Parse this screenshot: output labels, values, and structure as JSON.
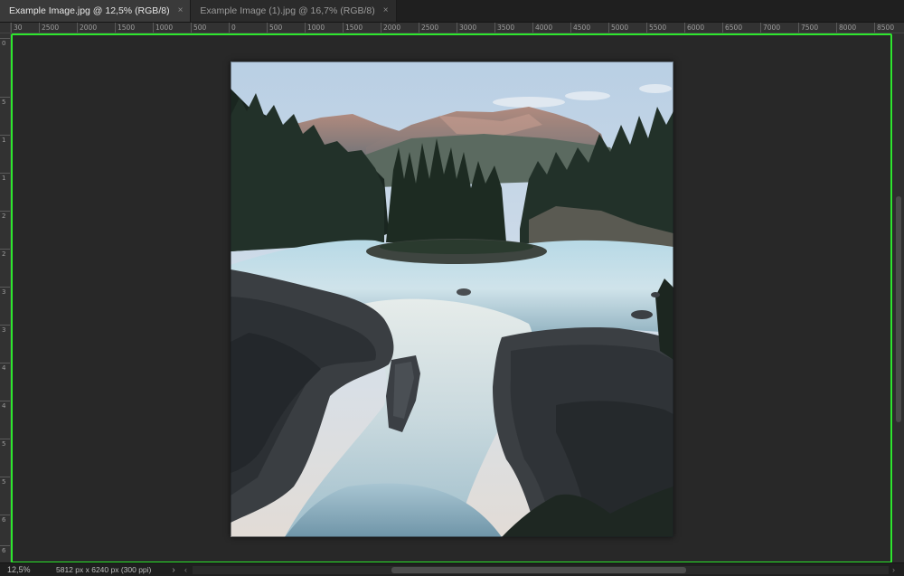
{
  "tabs": [
    {
      "label": "Example Image.jpg @ 12,5% (RGB/8)",
      "close": "×",
      "active": true
    },
    {
      "label": "Example Image (1).jpg @ 16,7% (RGB/8)",
      "close": "×",
      "active": false
    }
  ],
  "ruler": {
    "top_labels": [
      "30",
      "2500",
      "2000",
      "1500",
      "1000",
      "500",
      "0",
      "500",
      "1000",
      "1500",
      "2000",
      "2500",
      "3000",
      "3500",
      "4000",
      "4500",
      "5000",
      "5500",
      "6000",
      "6500",
      "7000",
      "7500",
      "8000",
      "8500"
    ],
    "left_labels": [
      "0",
      "5",
      "1",
      "1",
      "2",
      "2",
      "3",
      "3",
      "4",
      "4",
      "5",
      "5",
      "6",
      "6"
    ]
  },
  "status": {
    "zoom": "12,5%",
    "doc_info": "5812 px x 6240 px (300 ppi)",
    "nav_arrow": "›",
    "scroll_left": "‹",
    "scroll_right": "›"
  },
  "colors": {
    "highlight": "#2ee62e",
    "app_bg": "#282828"
  }
}
